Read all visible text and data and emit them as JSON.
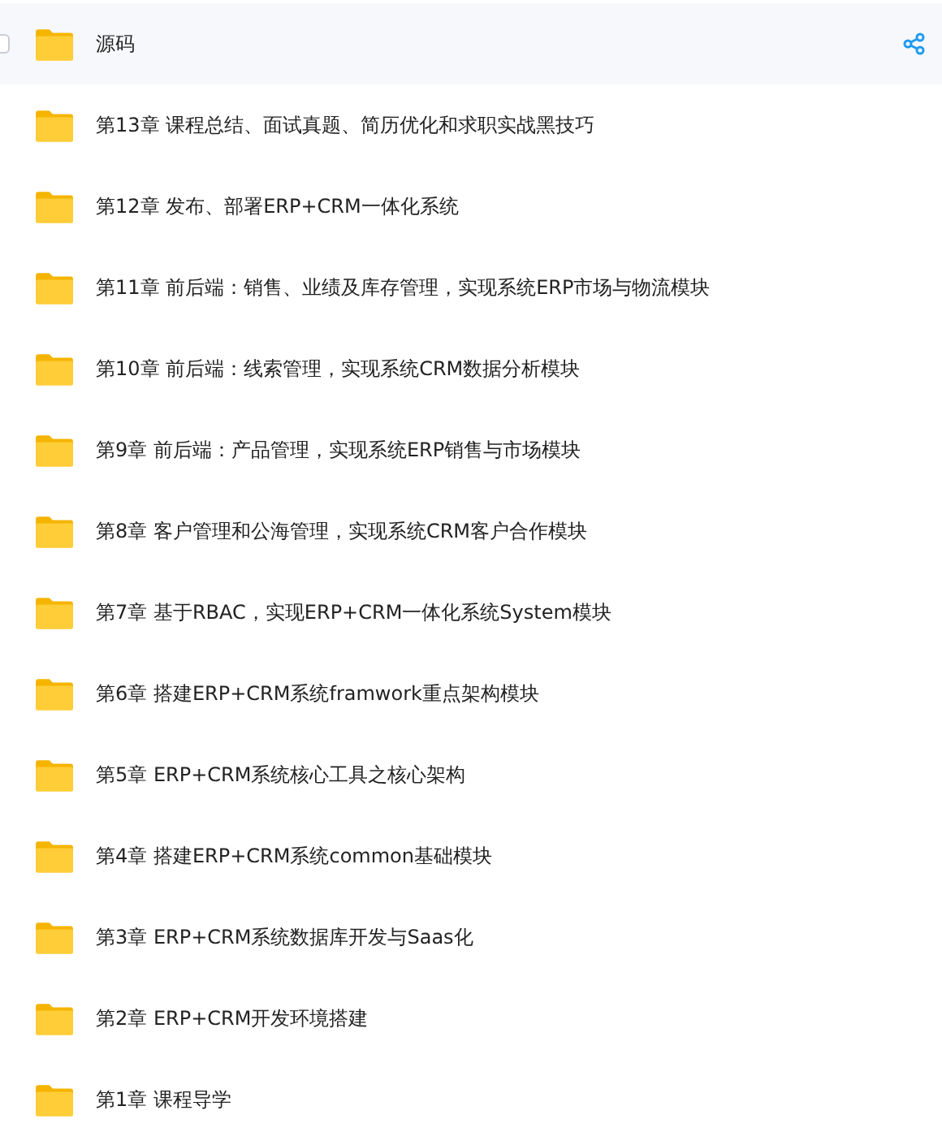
{
  "folders": [
    {
      "name": "源码",
      "hovered": true
    },
    {
      "name": "第13章 课程总结、面试真题、简历优化和求职实战黑技巧",
      "hovered": false
    },
    {
      "name": "第12章 发布、部署ERP+CRM一体化系统",
      "hovered": false
    },
    {
      "name": "第11章 前后端：销售、业绩及库存管理，实现系统ERP市场与物流模块",
      "hovered": false
    },
    {
      "name": "第10章 前后端：线索管理，实现系统CRM数据分析模块",
      "hovered": false
    },
    {
      "name": "第9章 前后端：产品管理，实现系统ERP销售与市场模块",
      "hovered": false
    },
    {
      "name": "第8章 客户管理和公海管理，实现系统CRM客户合作模块",
      "hovered": false
    },
    {
      "name": "第7章 基于RBAC，实现ERP+CRM一体化系统System模块",
      "hovered": false
    },
    {
      "name": "第6章 搭建ERP+CRM系统framwork重点架构模块",
      "hovered": false
    },
    {
      "name": "第5章 ERP+CRM系统核心工具之核心架构",
      "hovered": false
    },
    {
      "name": "第4章 搭建ERP+CRM系统common基础模块",
      "hovered": false
    },
    {
      "name": "第3章 ERP+CRM系统数据库开发与Saas化",
      "hovered": false
    },
    {
      "name": "第2章 ERP+CRM开发环境搭建",
      "hovered": false
    },
    {
      "name": "第1章 课程导学",
      "hovered": false
    }
  ]
}
